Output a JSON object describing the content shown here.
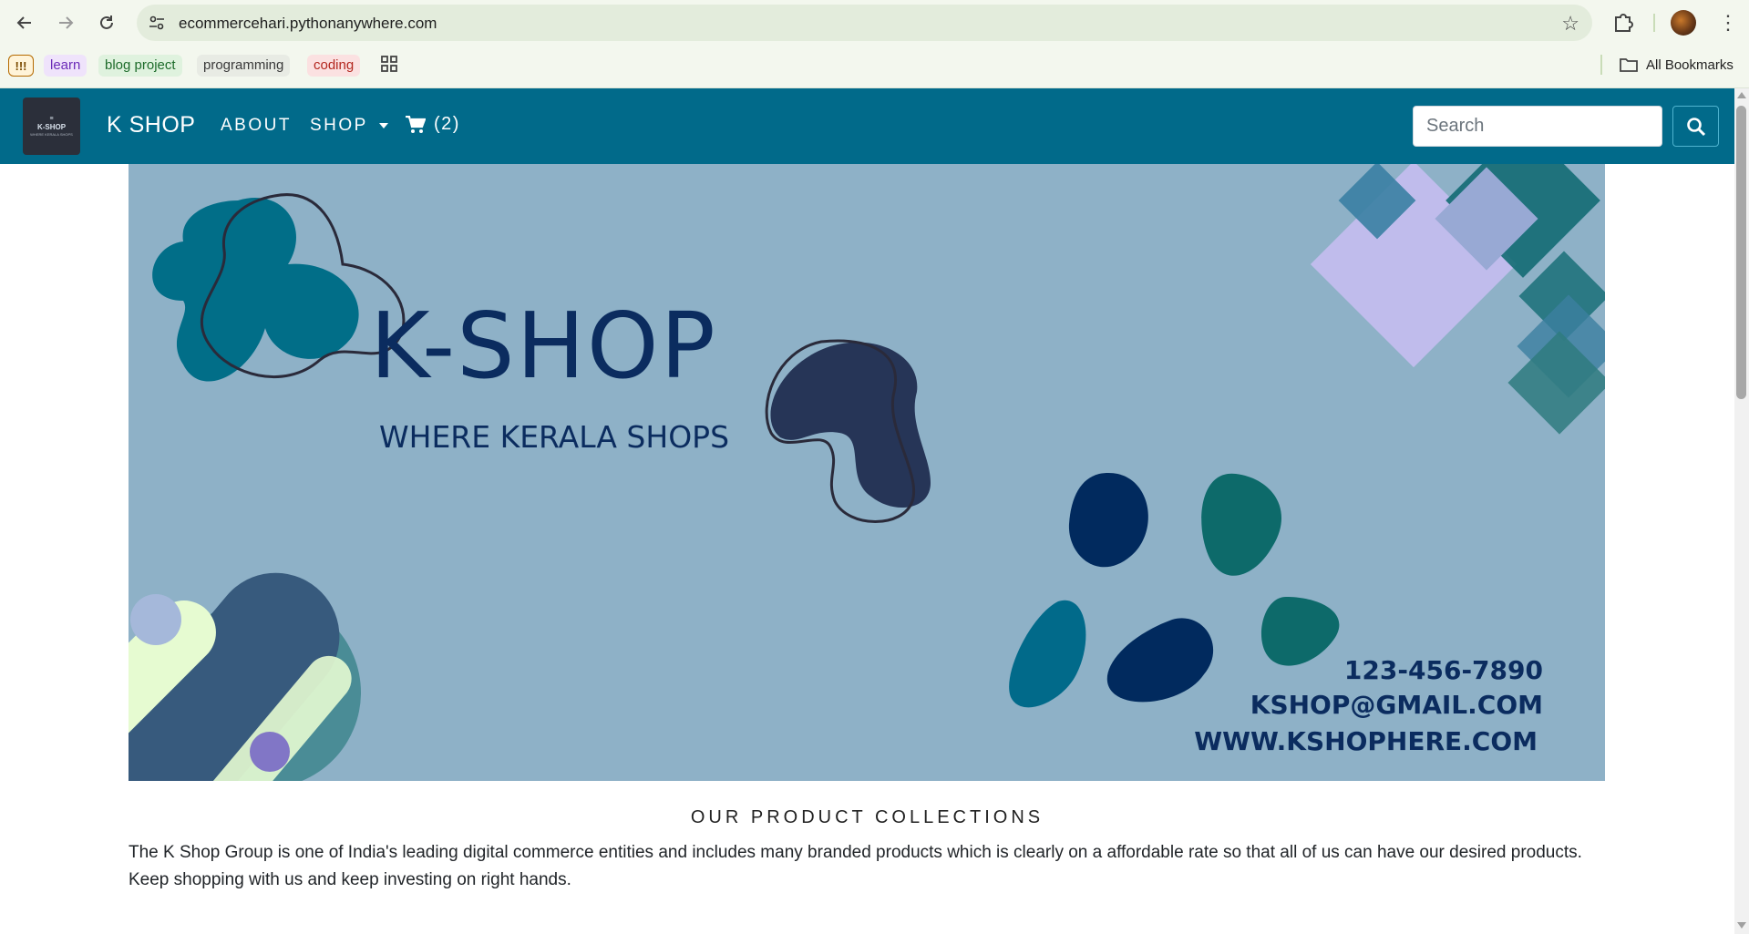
{
  "browser": {
    "url": "ecommercehari.pythonanywhere.com",
    "bookmarks": [
      "!!!",
      "learn",
      "blog project",
      "programming",
      "coding"
    ],
    "all_bookmarks_label": "All Bookmarks"
  },
  "navbar": {
    "logo_text": {
      "line1": "≡",
      "line2": "K-SHOP",
      "line3": "WHERE KERALA SHOPS"
    },
    "brand": "K SHOP",
    "links": [
      "ABOUT",
      "SHOP"
    ],
    "cart_count": "(2)",
    "search_placeholder": "Search"
  },
  "banner": {
    "title": "K-SHOP",
    "tagline": "WHERE KERALA SHOPS",
    "phone": "123-456-7890",
    "email": "KSHOP@GMAIL.COM",
    "website": "WWW.KSHOPHERE.COM"
  },
  "content": {
    "section_title": "OUR PRODUCT COLLECTIONS",
    "description": "The K Shop Group is one of India's leading digital commerce entities and includes many branded products which is clearly on a affordable rate so that all of us can have our desired products. Keep shopping with us and keep investing on right hands."
  },
  "colors": {
    "navbar": "#016a8a",
    "banner_bg": "#8eb1c7",
    "banner_text": "#0b2c5f"
  }
}
